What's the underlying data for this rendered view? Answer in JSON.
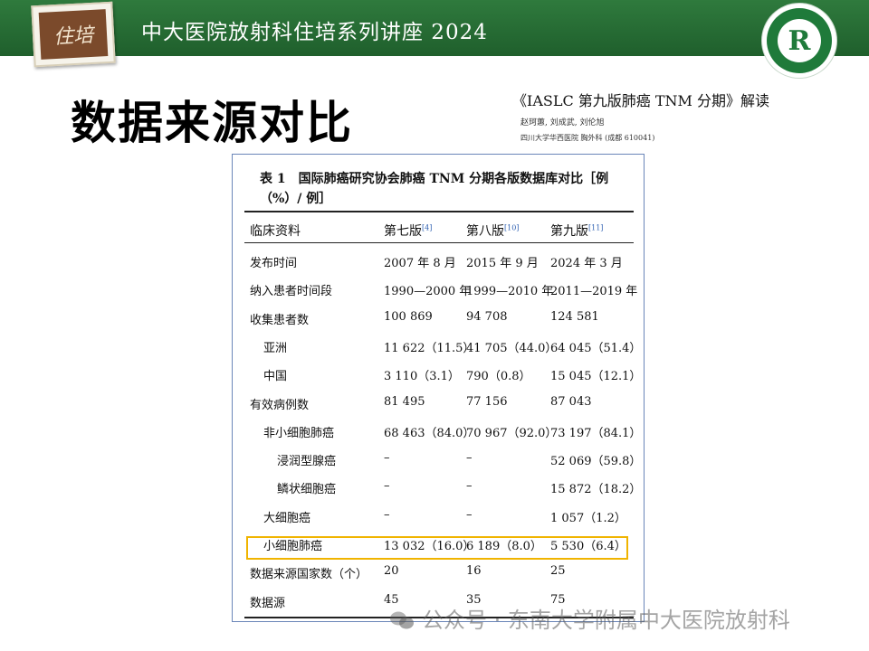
{
  "header": {
    "badge_text": "住培",
    "title": "中大医院放射科住培系列讲座 2024",
    "logo_letter": "R"
  },
  "page_title": "数据来源对比",
  "paper": {
    "title": "《IASLC 第九版肺癌 TNM 分期》解读",
    "authors": "赵珂蕙, 刘成武, 刘伦旭",
    "affiliation": "四川大学华西医院 胸外科 (成都 610041)"
  },
  "table": {
    "caption": "表 1　国际肺癌研究协会肺癌 TNM 分期各版数据库对比［例（%）/ 例］",
    "columns": [
      {
        "label": "临床资料",
        "ref": ""
      },
      {
        "label": "第七版",
        "ref": "[4]"
      },
      {
        "label": "第八版",
        "ref": "[10]"
      },
      {
        "label": "第九版",
        "ref": "[11]"
      }
    ],
    "rows": [
      {
        "label": "发布时间",
        "v7": "2007 年 8 月",
        "v8": "2015 年 9 月",
        "v9": "2024 年 3 月"
      },
      {
        "label": "纳入患者时间段",
        "v7": "1990—2000 年",
        "v8": "1999—2010 年",
        "v9": "2011—2019 年"
      },
      {
        "label": "收集患者数",
        "v7": "100 869",
        "v8": "94 708",
        "v9": "124 581"
      },
      {
        "label": "亚洲",
        "v7": "11 622（11.5）",
        "v8": "41 705（44.0）",
        "v9": "64 045（51.4）"
      },
      {
        "label": "中国",
        "v7": "3 110（3.1）",
        "v8": "790（0.8）",
        "v9": "15 045（12.1）"
      },
      {
        "label": "有效病例数",
        "v7": "81 495",
        "v8": "77 156",
        "v9": "87 043"
      },
      {
        "label": "非小细胞肺癌",
        "v7": "68 463（84.0）",
        "v8": "70 967（92.0）",
        "v9": "73 197（84.1）"
      },
      {
        "label": "浸润型腺癌",
        "v7": "–",
        "v8": "–",
        "v9": "52 069（59.8）"
      },
      {
        "label": "鳞状细胞癌",
        "v7": "–",
        "v8": "–",
        "v9": "15 872（18.2）"
      },
      {
        "label": "大细胞癌",
        "v7": "–",
        "v8": "–",
        "v9": "1 057（1.2）"
      },
      {
        "label": "小细胞肺癌",
        "v7": "13 032（16.0）",
        "v8": "6 189（8.0）",
        "v9": "5 530（6.4）"
      },
      {
        "label": "数据来源国家数（个）",
        "v7": "20",
        "v8": "16",
        "v9": "25"
      },
      {
        "label": "数据源",
        "v7": "45",
        "v8": "35",
        "v9": "75"
      }
    ]
  },
  "watermark": "公众号 · 东南大学附属中大医院放射科",
  "colors": {
    "header_green": "#2f7a3d",
    "highlight": "#f0b400",
    "ref_blue": "#2a5db0"
  }
}
